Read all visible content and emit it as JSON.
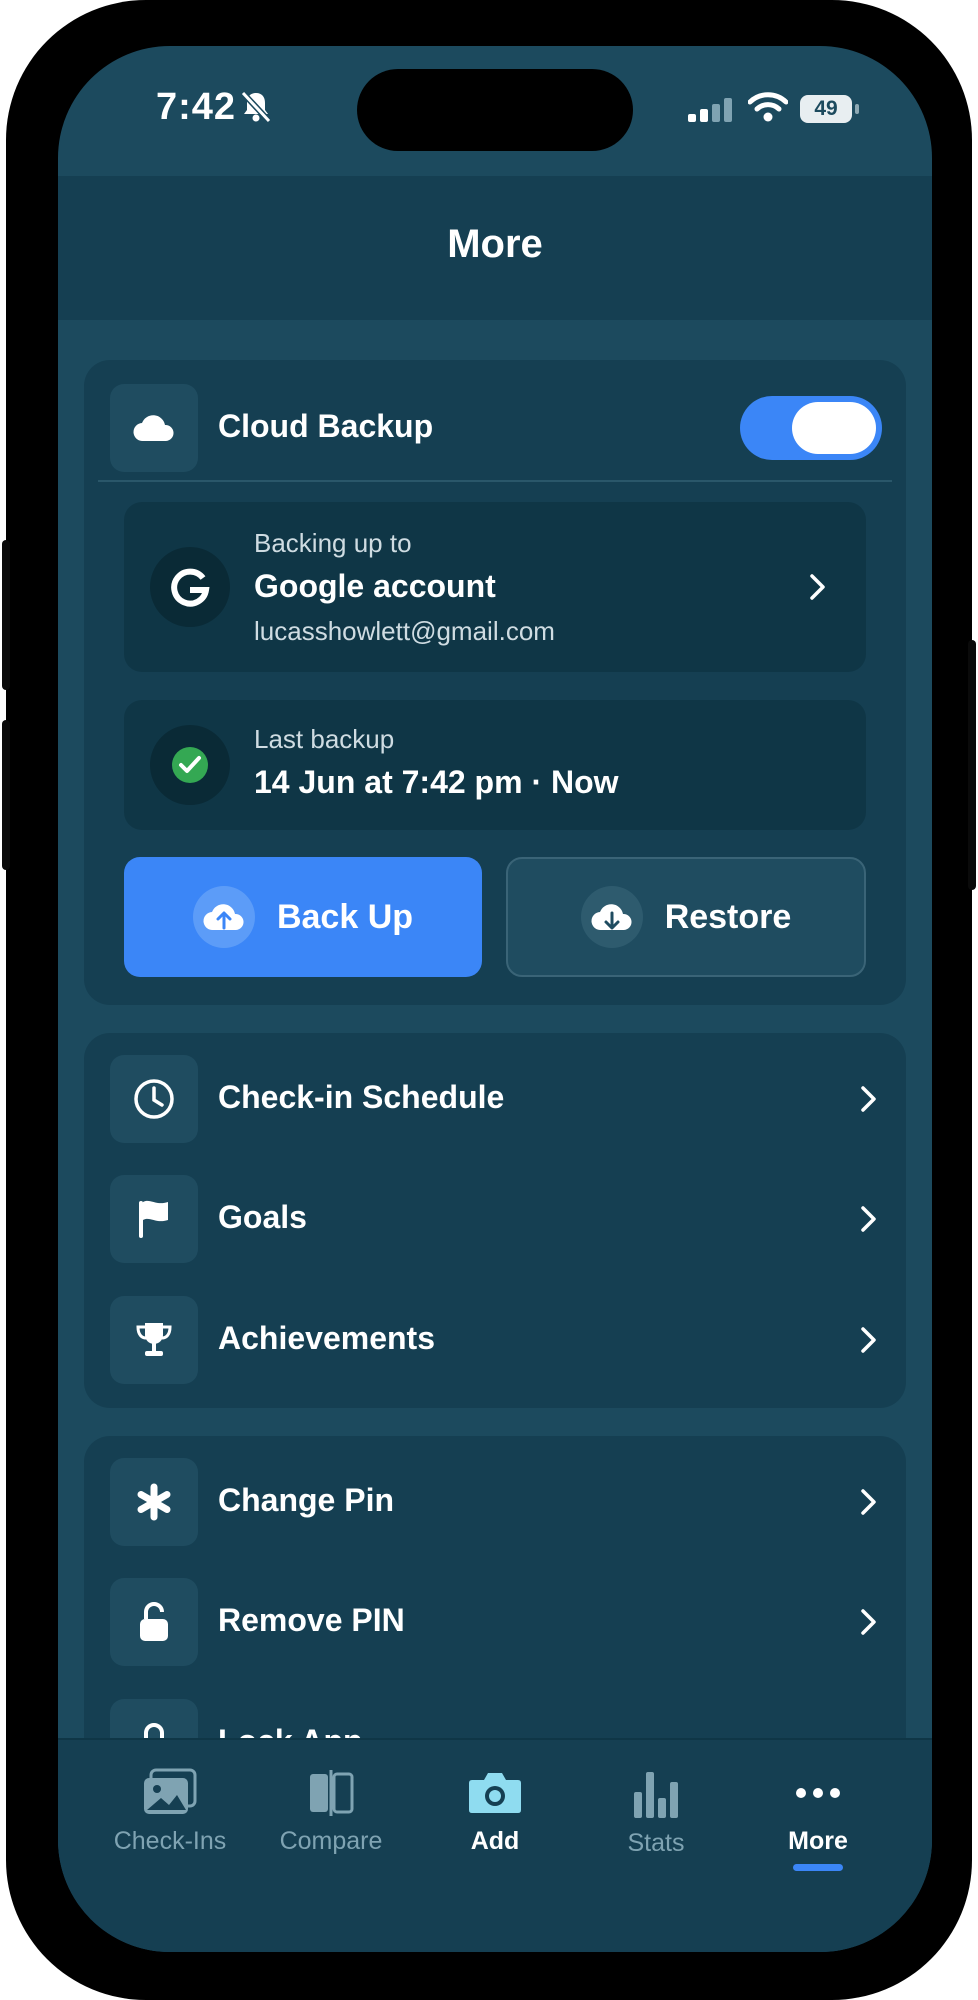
{
  "status_bar": {
    "time": "7:42",
    "battery": "49"
  },
  "header": {
    "title": "More"
  },
  "cloud_backup": {
    "title": "Cloud Backup",
    "enabled": true,
    "account": {
      "caption": "Backing up to",
      "name": "Google account",
      "email": "lucasshowlett@gmail.com"
    },
    "last_backup": {
      "caption": "Last backup",
      "value": "14 Jun at 7:42 pm · Now"
    },
    "back_up_label": "Back Up",
    "restore_label": "Restore"
  },
  "settings_group_1": {
    "items": [
      {
        "label": "Check-in Schedule",
        "icon": "clock-icon"
      },
      {
        "label": "Goals",
        "icon": "flag-icon"
      },
      {
        "label": "Achievements",
        "icon": "trophy-icon"
      }
    ]
  },
  "settings_group_2": {
    "items": [
      {
        "label": "Change Pin",
        "icon": "asterisk-icon"
      },
      {
        "label": "Remove PIN",
        "icon": "unlock-icon"
      },
      {
        "label": "Lock App",
        "icon": "lock-icon"
      }
    ]
  },
  "tab_bar": {
    "tabs": [
      {
        "label": "Check-Ins",
        "icon": "photos-icon"
      },
      {
        "label": "Compare",
        "icon": "compare-icon"
      },
      {
        "label": "Add",
        "icon": "camera-icon"
      },
      {
        "label": "Stats",
        "icon": "bar-chart-icon"
      },
      {
        "label": "More",
        "icon": "more-dots-icon"
      }
    ],
    "active": "More"
  },
  "colors": {
    "background": "#1c4a5e",
    "card": "#153f52",
    "accent": "#3b86f7",
    "success": "#34a853"
  }
}
